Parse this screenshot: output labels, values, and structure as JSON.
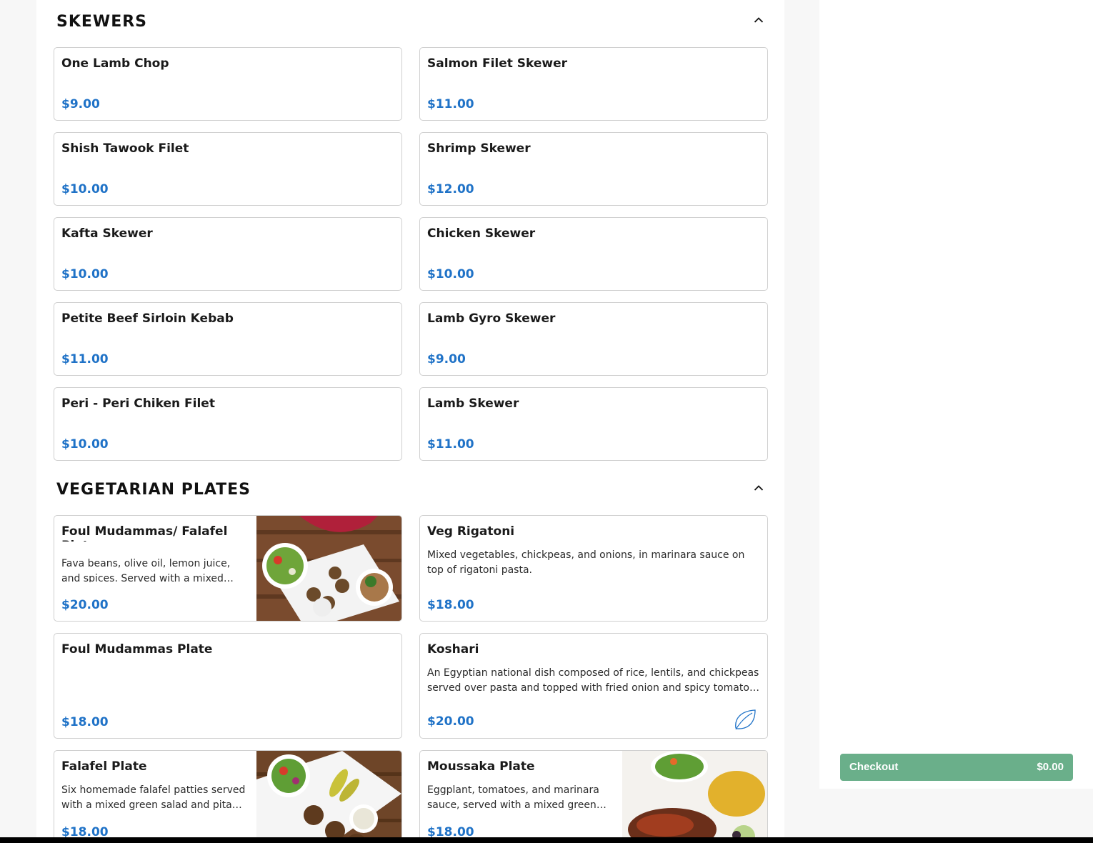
{
  "sections": [
    {
      "title": "SKEWERS",
      "items": [
        {
          "name": "One Lamb Chop",
          "price": "$9.00"
        },
        {
          "name": "Salmon Filet Skewer",
          "price": "$11.00"
        },
        {
          "name": "Shish Tawook Filet",
          "price": "$10.00"
        },
        {
          "name": "Shrimp Skewer",
          "price": "$12.00"
        },
        {
          "name": "Kafta Skewer",
          "price": "$10.00"
        },
        {
          "name": "Chicken Skewer",
          "price": "$10.00"
        },
        {
          "name": "Petite Beef Sirloin Kebab",
          "price": "$11.00"
        },
        {
          "name": "Lamb Gyro Skewer",
          "price": "$9.00"
        },
        {
          "name": "Peri - Peri Chiken Filet",
          "price": "$10.00"
        },
        {
          "name": "Lamb Skewer",
          "price": "$11.00"
        }
      ]
    },
    {
      "title": "VEGETARIAN PLATES",
      "items": [
        {
          "name": "Foul Mudammas/ Falafel Plate",
          "desc": "Fava beans, olive oil, lemon juice, and spices. Served with a mixed green salad and pita bread.",
          "price": "$20.00"
        },
        {
          "name": "Veg Rigatoni",
          "desc": "Mixed vegetables, chickpeas, and onions, in marinara sauce on top of rigatoni pasta.",
          "price": "$18.00"
        },
        {
          "name": "Foul Mudammas Plate",
          "price": "$18.00"
        },
        {
          "name": "Koshari",
          "desc": "An Egyptian national dish composed of rice, lentils, and chickpeas served over pasta and topped with fried onion and spicy tomato sauce.",
          "price": "$20.00",
          "icon": "leaf-icon"
        },
        {
          "name": "Falafel Plate",
          "desc": "Six homemade falafel patties served with a mixed green salad and pita bread.",
          "price": "$18.00"
        },
        {
          "name": "Moussaka Plate",
          "desc": "Eggplant, tomatoes, and marinara sauce, served with a mixed green salad and pita bread.",
          "price": "$18.00"
        }
      ]
    }
  ],
  "cart": {
    "checkout_label": "Checkout",
    "total": "$0.00"
  },
  "colors": {
    "price": "#1f72c7",
    "checkout": "#6aaf8a"
  }
}
